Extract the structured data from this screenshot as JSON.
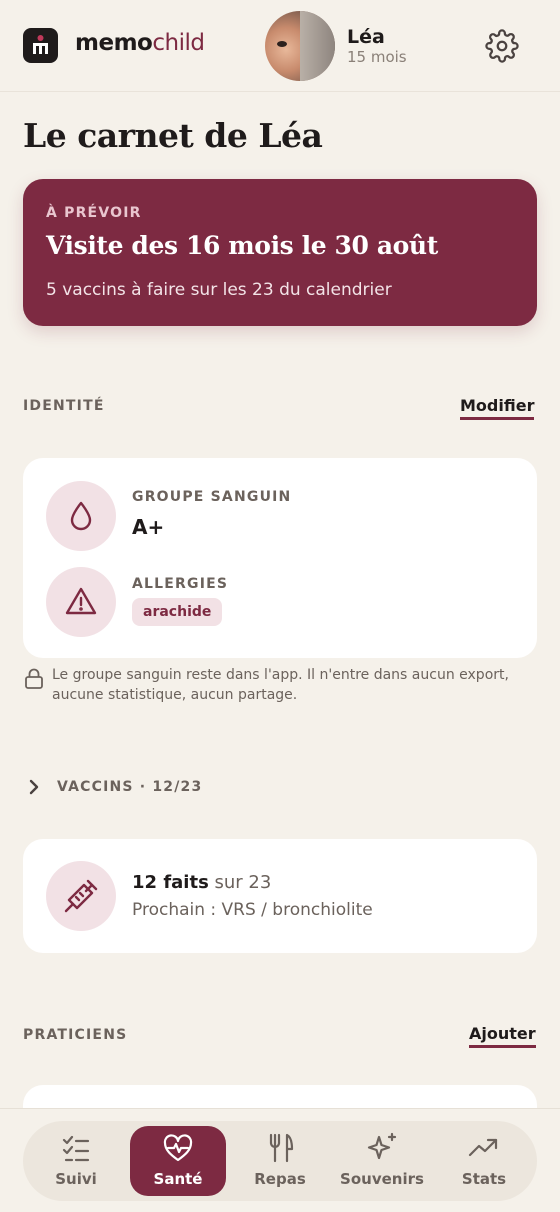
{
  "app": {
    "brand_part1": "memo",
    "brand_part2": "child"
  },
  "header": {
    "child_name": "Léa",
    "child_age": "15 mois"
  },
  "page": {
    "title": "Le carnet de Léa"
  },
  "upcoming": {
    "eyebrow": "À PRÉVOIR",
    "headline": "Visite des 16 mois le 30 août",
    "subtext": "5 vaccins à faire sur les 23 du calendrier"
  },
  "identity": {
    "section_label": "IDENTITÉ",
    "edit_label": "Modifier",
    "blood_group_label": "GROUPE SANGUIN",
    "blood_group_value": "A+",
    "allergies_label": "ALLERGIES",
    "allergies": [
      "arachide"
    ],
    "privacy_note": "Le groupe sanguin reste dans l'app. Il n'entre dans aucun export, aucune statistique, aucun partage."
  },
  "vaccines": {
    "section_label": "VACCINS · 12/23",
    "done_strong": "12 faits",
    "done_rest": "sur 23",
    "next": "Prochain : VRS / bronchiolite"
  },
  "practitioners": {
    "section_label": "PRATICIENS",
    "add_label": "Ajouter"
  },
  "nav": {
    "items": [
      {
        "label": "Suivi",
        "icon": "checklist-icon"
      },
      {
        "label": "Santé",
        "icon": "heart-pulse-icon",
        "active": true
      },
      {
        "label": "Repas",
        "icon": "utensils-icon"
      },
      {
        "label": "Souvenirs",
        "icon": "sparkles-icon"
      },
      {
        "label": "Stats",
        "icon": "trend-up-icon"
      }
    ]
  },
  "colors": {
    "accent": "#7d2a42",
    "background": "#f5f1ea",
    "accent_soft": "#f2e1e5"
  }
}
